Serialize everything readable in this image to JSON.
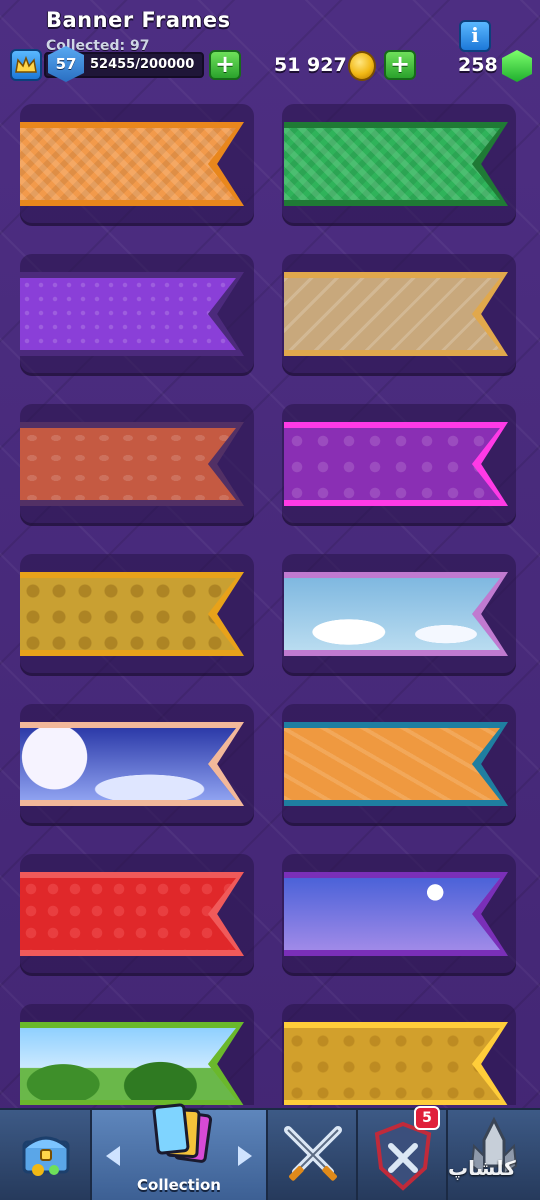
{
  "header": {
    "title": "Banner Frames",
    "collected": "Collected: 97",
    "level": "57",
    "xp": "52455/200000",
    "gold": "51 927",
    "gems": "258",
    "info_label": "i",
    "plus_label": "+"
  },
  "banners": [
    {
      "id": "orange-diamond",
      "border": "#e9871c",
      "fill": "#f29a4b",
      "pattern": "diamond"
    },
    {
      "id": "green-diamond",
      "border": "#1f7a35",
      "fill": "#2fb35a",
      "pattern": "diamond"
    },
    {
      "id": "purple-dots",
      "border": "#4c2a7c",
      "fill": "#8a3fd8",
      "pattern": "dots"
    },
    {
      "id": "tan-swords",
      "border": "#e1a84c",
      "fill": "#c8a87c",
      "pattern": "swords"
    },
    {
      "id": "rust-butterfly",
      "border": "#523065",
      "fill": "#c55a42",
      "pattern": "butterfly"
    },
    {
      "id": "magenta-skulls",
      "border": "#ff3ae6",
      "fill": "#8a2fb4",
      "pattern": "skulls"
    },
    {
      "id": "gold-gears",
      "border": "#e8a21a",
      "fill": "#c9a032",
      "pattern": "gears"
    },
    {
      "id": "sky-clouds",
      "border": "#c07ad0",
      "fill": "#76b5dc",
      "pattern": "clouds"
    },
    {
      "id": "night-moon",
      "border": "#f2b89a",
      "fill": "#4b5fd6",
      "pattern": "night"
    },
    {
      "id": "orange-arrows",
      "border": "#1f7ea0",
      "fill": "#ef9940",
      "pattern": "arrows"
    },
    {
      "id": "red-hearts",
      "border": "#f05a5a",
      "fill": "#e0282a",
      "pattern": "hearts"
    },
    {
      "id": "party-crowd",
      "border": "#7a2fb8",
      "fill": "#7e76d8",
      "pattern": "party"
    },
    {
      "id": "forest-scene",
      "border": "#6ab82c",
      "fill": "#7ac04a",
      "pattern": "forest"
    },
    {
      "id": "gold-trophies",
      "border": "#ffcd3a",
      "fill": "#d2a02c",
      "pattern": "trophies"
    }
  ],
  "nav": {
    "collection_label": "Collection",
    "notification_count": "5"
  },
  "watermark": "کلشاپ"
}
